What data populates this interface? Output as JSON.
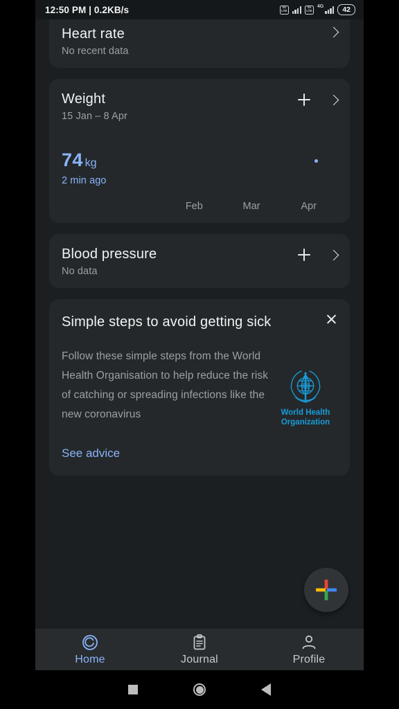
{
  "status_bar": {
    "time_and_speed": "12:50 PM | 0.2KB/s",
    "volte_top": "Vo",
    "volte_bottom": "LTE",
    "network": "4G",
    "battery": "42"
  },
  "cards": {
    "heart_rate": {
      "title": "Heart rate",
      "subtitle": "No recent data"
    },
    "weight": {
      "title": "Weight",
      "subtitle": "15 Jan – 8 Apr",
      "value": "74",
      "unit": "kg",
      "timestamp": "2 min ago",
      "axis": [
        "Feb",
        "Mar",
        "Apr"
      ]
    },
    "blood_pressure": {
      "title": "Blood pressure",
      "subtitle": "No data"
    },
    "who_tip": {
      "title": "Simple steps to avoid getting sick",
      "body": "Follow these simple steps from the World Health Organisation to help reduce the risk of catching or spreading infections like the new coronavirus",
      "logo_line1": "World Health",
      "logo_line2": "Organization",
      "link": "See advice"
    }
  },
  "fab": {
    "label": "add-entry",
    "colors": {
      "red": "#ea4335",
      "blue": "#4285f4",
      "green": "#34a853",
      "yellow": "#fbbc04"
    }
  },
  "bottom_nav": {
    "items": [
      {
        "label": "Home",
        "icon": "home-ring-icon",
        "active": true
      },
      {
        "label": "Journal",
        "icon": "clipboard-icon",
        "active": false
      },
      {
        "label": "Profile",
        "icon": "person-icon",
        "active": false
      }
    ]
  },
  "theme": {
    "accent_blue": "#8ab4f8",
    "who_blue": "#1a9bd7",
    "card_bg": "#24282b",
    "page_bg": "#1b1f22"
  }
}
